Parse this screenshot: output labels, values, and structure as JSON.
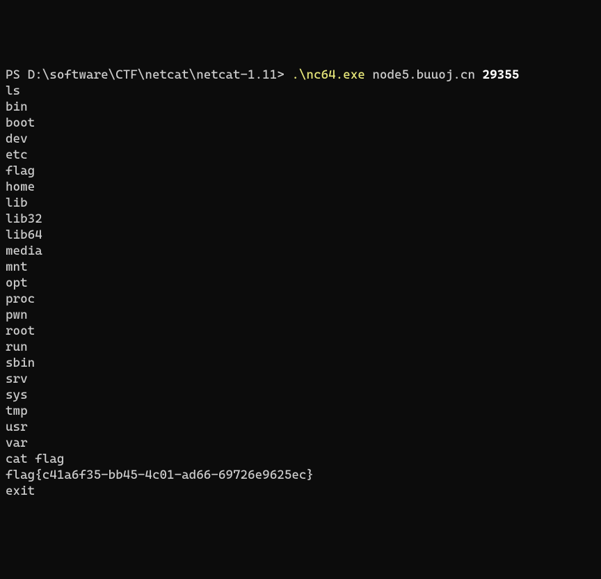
{
  "prompt": {
    "prefix": "PS D:\\software\\CTF\\netcat\\netcat-1.11> ",
    "executable": ".\\nc64.exe",
    "host": " node5.buuoj.cn ",
    "port": "29355"
  },
  "output_lines": [
    "ls",
    "bin",
    "boot",
    "dev",
    "etc",
    "flag",
    "home",
    "lib",
    "lib32",
    "lib64",
    "media",
    "mnt",
    "opt",
    "proc",
    "pwn",
    "root",
    "run",
    "sbin",
    "srv",
    "sys",
    "tmp",
    "usr",
    "var",
    "cat flag",
    "flag{c41a6f35-bb45-4c01-ad66-69726e9625ec}",
    "exit"
  ]
}
